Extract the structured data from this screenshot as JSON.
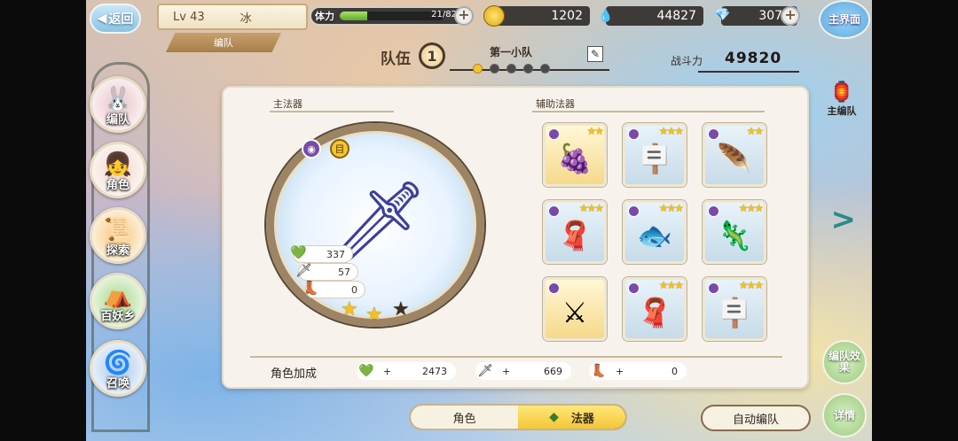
{
  "topbar": {
    "back_label": "返回",
    "level": "Lv 43",
    "player_name": "冰",
    "team_tag": "编队",
    "stamina_label": "体力",
    "stamina_text": "21/82",
    "stamina_fraction": 0.26,
    "gold": "1202",
    "crystal": "44827",
    "gem": "3070",
    "main_screen_label": "主界面"
  },
  "squad": {
    "label": "队伍",
    "number": "1",
    "name": "第一小队",
    "active_dot": 0,
    "power_label": "战斗力",
    "power_value": "49820"
  },
  "side_nav": [
    {
      "label": "编队",
      "art": "🐰",
      "color": "#e9c4c9"
    },
    {
      "label": "角色",
      "art": "👧",
      "color": "#f0d6c8"
    },
    {
      "label": "探索",
      "art": "📜",
      "color": "#f5c77a"
    },
    {
      "label": "百妖乡",
      "art": "⛺",
      "color": "#a8d88a"
    },
    {
      "label": "召唤",
      "art": "🌀",
      "color": "#a9c8ea"
    }
  ],
  "right_nav": {
    "main_team": "主编队",
    "team_effect": "编队效果",
    "details": "详情"
  },
  "panel": {
    "main_title": "主法器",
    "aux_title": "辅助法器",
    "main_weapon": {
      "art": "🗡",
      "stats": [
        {
          "icon": "💚",
          "value": "337"
        },
        {
          "icon": "🗡",
          "value": "57"
        },
        {
          "icon": "👢",
          "value": "0"
        }
      ],
      "stars": 2,
      "max_stars": 3
    },
    "slots": [
      {
        "art": "🍇",
        "stars": "★★",
        "gold": true
      },
      {
        "art": "🪧",
        "stars": "★★★",
        "gold": false
      },
      {
        "art": "🪶",
        "stars": "★★",
        "gold": false
      },
      {
        "art": "🧣",
        "stars": "★★★",
        "gold": false
      },
      {
        "art": "🐟",
        "stars": "★★★",
        "gold": false
      },
      {
        "art": "🦎",
        "stars": "★★★",
        "gold": false
      },
      {
        "art": "⚔",
        "stars": "",
        "gold": true
      },
      {
        "art": "🧣",
        "stars": "★★★",
        "gold": false
      },
      {
        "art": "🪧",
        "stars": "★★★",
        "gold": false
      }
    ],
    "bonus_label": "角色加成",
    "bonus": [
      {
        "icon": "💚",
        "plus": "+",
        "value": "2473"
      },
      {
        "icon": "🗡",
        "plus": "+",
        "value": "669"
      },
      {
        "icon": "👢",
        "plus": "+",
        "value": "0"
      }
    ]
  },
  "bottom": {
    "tab_character": "角色",
    "tab_weapon": "法器",
    "auto_button": "自动编队"
  }
}
